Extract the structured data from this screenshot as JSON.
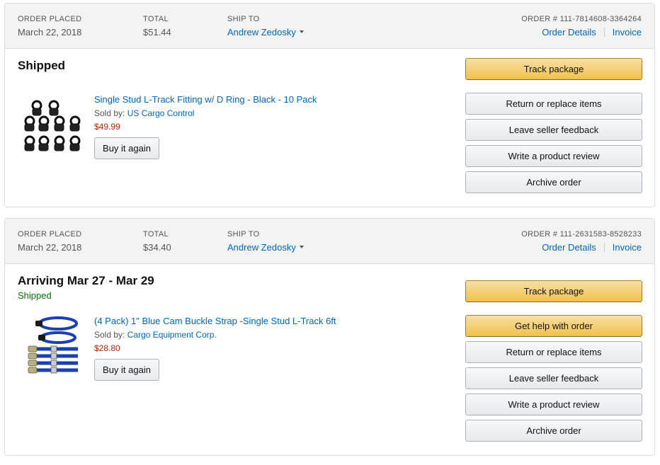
{
  "orders": [
    {
      "placed_label": "ORDER PLACED",
      "placed_date": "March 22, 2018",
      "total_label": "TOTAL",
      "total": "$51.44",
      "ship_label": "SHIP TO",
      "ship_name": "Andrew Zedosky",
      "order_number": "ORDER # 111-7814608-3364264",
      "details_link": "Order Details",
      "invoice_link": "Invoice",
      "status": "Shipped",
      "item": {
        "title": "Single Stud L-Track Fitting w/ D Ring - Black - 10 Pack",
        "sold_by_label": "Sold by:",
        "seller": "US Cargo Control",
        "price": "$49.99",
        "buy_again": "Buy it again",
        "image_icon": "black-d-ring-fittings-image"
      },
      "actions": {
        "track": "Track package",
        "return": "Return or replace items",
        "feedback": "Leave seller feedback",
        "review": "Write a product review",
        "archive": "Archive order"
      }
    },
    {
      "placed_label": "ORDER PLACED",
      "placed_date": "March 22, 2018",
      "total_label": "TOTAL",
      "total": "$34.40",
      "ship_label": "SHIP TO",
      "ship_name": "Andrew Zedosky",
      "order_number": "ORDER # 111-2631583-8528233",
      "details_link": "Order Details",
      "invoice_link": "Invoice",
      "status": "Arriving Mar 27 - Mar 29",
      "substatus": "Shipped",
      "item": {
        "title": "(4 Pack) 1\" Blue Cam Buckle Strap -Single Stud L-Track 6ft",
        "sold_by_label": "Sold by:",
        "seller": "Cargo Equipment Corp.",
        "price": "$28.80",
        "buy_again": "Buy it again",
        "image_icon": "blue-cam-buckle-straps-image"
      },
      "actions": {
        "track": "Track package",
        "help": "Get help with order",
        "return": "Return or replace items",
        "feedback": "Leave seller feedback",
        "review": "Write a product review",
        "archive": "Archive order"
      }
    }
  ],
  "colors": {
    "link": "#0066c0",
    "price": "#b12704",
    "shipped_green": "#007600",
    "primary_button": "#f0c14b",
    "header_bg": "#f3f3f3"
  }
}
